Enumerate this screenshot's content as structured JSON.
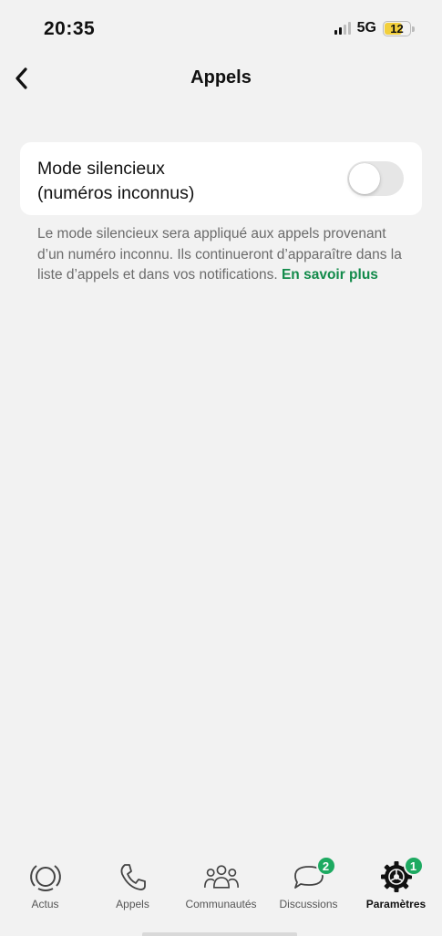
{
  "status_bar": {
    "time": "20:35",
    "network": "5G",
    "battery": "12"
  },
  "nav": {
    "title": "Appels"
  },
  "setting": {
    "label_line1": "Mode silencieux",
    "label_line2": "(numéros inconnus)",
    "enabled": false
  },
  "footnote": {
    "text": "Le mode silencieux sera appliqué aux appels provenant d’un numéro inconnu. Ils continueront d’apparaître dans la liste d’appels et dans vos notifications.",
    "link": "En savoir plus"
  },
  "tabs": [
    {
      "label": "Actus",
      "icon": "updates-icon"
    },
    {
      "label": "Appels",
      "icon": "phone-icon"
    },
    {
      "label": "Communautés",
      "icon": "communities-icon"
    },
    {
      "label": "Discussions",
      "icon": "chat-icon",
      "badge": "2"
    },
    {
      "label": "Paramètres",
      "icon": "settings-icon",
      "badge": "1",
      "active": true
    }
  ],
  "colors": {
    "accent": "#1daa61",
    "link": "#128a4a",
    "background": "#f2f2f2",
    "battery": "#f2cf3c"
  }
}
